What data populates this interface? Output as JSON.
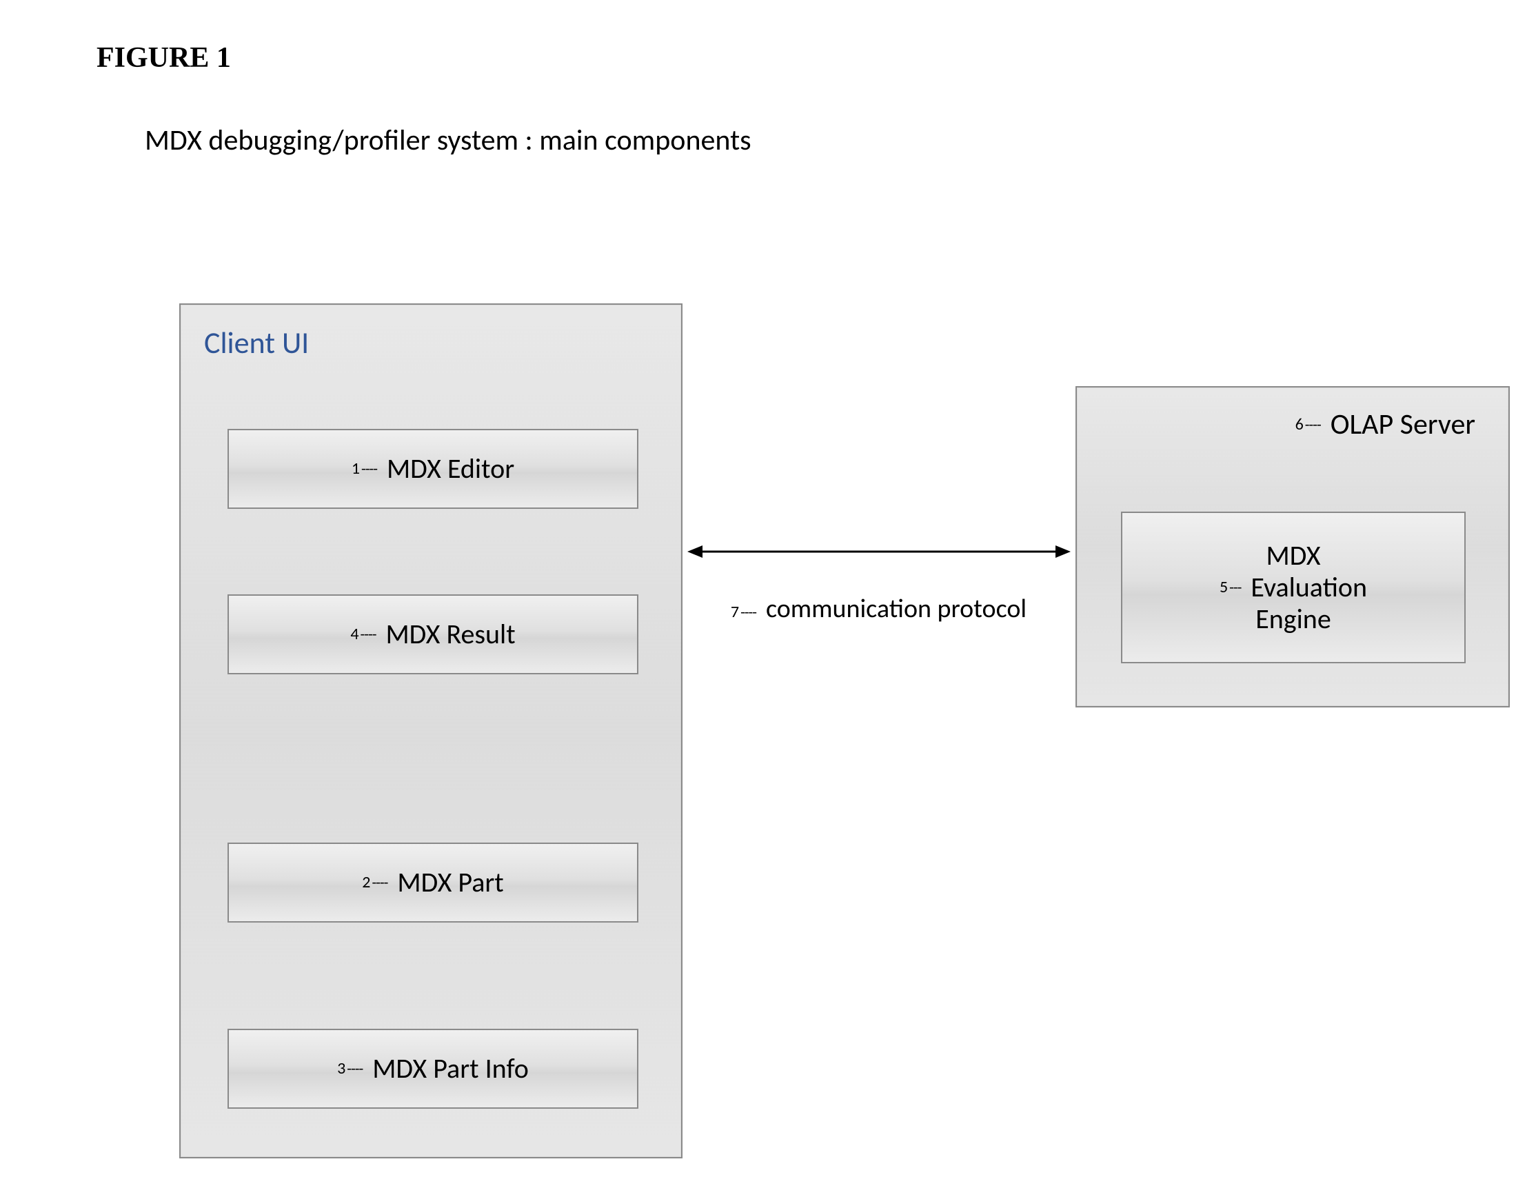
{
  "figure_label": "FIGURE 1",
  "subtitle": "MDX debugging/profiler system : main components",
  "client_panel": {
    "title": "Client UI",
    "boxes": {
      "editor": {
        "ref": "1",
        "label": "MDX Editor"
      },
      "result": {
        "ref": "4",
        "label": "MDX Result"
      },
      "part": {
        "ref": "2",
        "label": "MDX Part"
      },
      "partinfo": {
        "ref": "3",
        "label": "MDX Part Info"
      }
    }
  },
  "server_panel": {
    "title_ref": "6",
    "title": "OLAP Server",
    "engine": {
      "ref": "5",
      "line1": "MDX",
      "line2": "Evaluation",
      "line3": "Engine"
    }
  },
  "communication": {
    "ref": "7",
    "label": "communication protocol"
  },
  "ref_dashes": "----",
  "ref_dashes_short": "---"
}
